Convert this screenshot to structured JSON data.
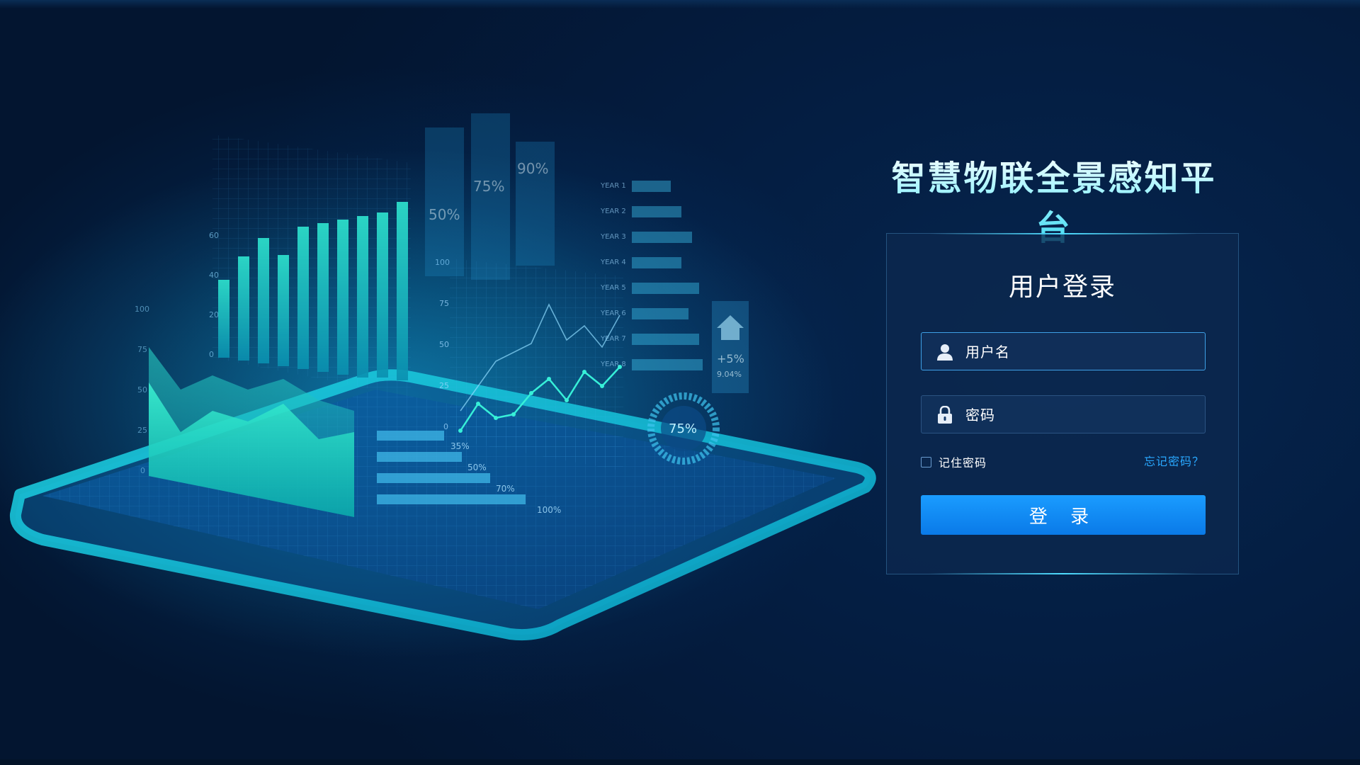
{
  "platform_title": "智慧物联全景感知平台",
  "login": {
    "title": "用户登录",
    "username_placeholder": "用户名",
    "password_placeholder": "密码",
    "remember_label": "记住密码",
    "forgot_link": "忘记密码？",
    "submit_label": "登 录"
  },
  "illustration": {
    "bar_axis_ticks": [
      "60",
      "40",
      "20",
      "0"
    ],
    "area_axis_ticks": [
      "100",
      "75",
      "50",
      "25",
      "0"
    ],
    "line_axis_ticks": [
      "100",
      "75",
      "50",
      "25",
      "0"
    ],
    "year_labels": [
      "YEAR 1",
      "YEAR 2",
      "YEAR 3",
      "YEAR 4",
      "YEAR 5",
      "YEAR 6",
      "YEAR 7",
      "YEAR 8"
    ],
    "panel_percents": [
      "50%",
      "75%",
      "90%"
    ],
    "progress_labels": [
      "35%",
      "50%",
      "70%",
      "100%"
    ],
    "gauge_label": "75%",
    "house_label": "+5%",
    "house_sub": "9.04%"
  },
  "colors": {
    "accent": "#1a9cff",
    "link": "#29a8ff",
    "title_gradient_end": "#36d6ee",
    "background": "#041d41",
    "teal": "#1fd6c4"
  }
}
